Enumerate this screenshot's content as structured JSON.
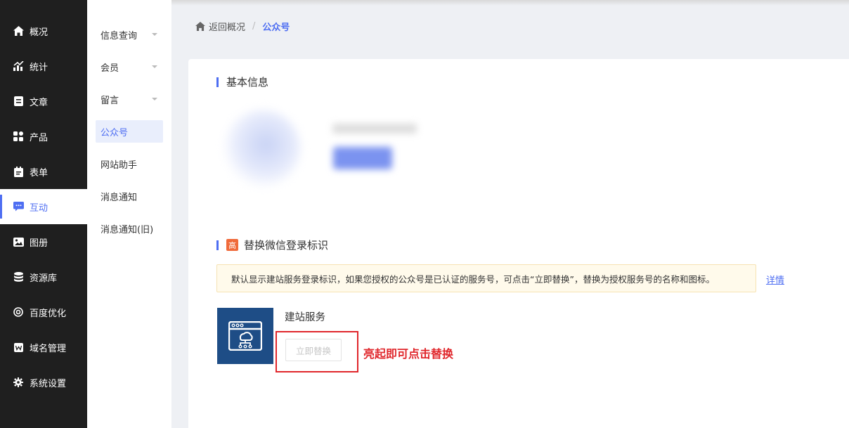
{
  "sidebar": {
    "items": [
      {
        "label": "概况",
        "icon": "home-icon"
      },
      {
        "label": "统计",
        "icon": "stats-icon"
      },
      {
        "label": "文章",
        "icon": "article-icon"
      },
      {
        "label": "产品",
        "icon": "product-icon"
      },
      {
        "label": "表单",
        "icon": "form-icon"
      },
      {
        "label": "互动",
        "icon": "chat-icon",
        "active": true
      },
      {
        "label": "图册",
        "icon": "album-icon"
      },
      {
        "label": "资源库",
        "icon": "database-icon"
      },
      {
        "label": "百度优化",
        "icon": "seo-icon"
      },
      {
        "label": "域名管理",
        "icon": "domain-icon"
      },
      {
        "label": "系统设置",
        "icon": "gear-icon"
      }
    ]
  },
  "subnav": {
    "items": [
      {
        "label": "信息查询",
        "expandable": true
      },
      {
        "label": "会员",
        "expandable": true
      },
      {
        "label": "留言",
        "expandable": true
      },
      {
        "label": "公众号",
        "active": true
      },
      {
        "label": "网站助手"
      },
      {
        "label": "消息通知"
      },
      {
        "label": "消息通知(旧)"
      }
    ]
  },
  "breadcrumb": {
    "back": "返回概况",
    "separator": "/",
    "current": "公众号"
  },
  "basic_info": {
    "title": "基本信息"
  },
  "replace_section": {
    "badge": "高",
    "title": "替换微信登录标识",
    "notice": "默认显示建站服务登录标识，如果您授权的公众号是已认证的服务号，可点击“立即替换”，替换为授权服务号的名称和图标。",
    "detail_link": "详情",
    "service_name": "建站服务",
    "replace_button": "立即替换",
    "annotation": "亮起即可点击替换"
  },
  "colors": {
    "accent": "#4e6ef2",
    "sidebar_bg": "#1f1f1f",
    "service_box": "#1e4d86",
    "annotation": "#e0262b",
    "badge_high": "#f06a3a"
  }
}
